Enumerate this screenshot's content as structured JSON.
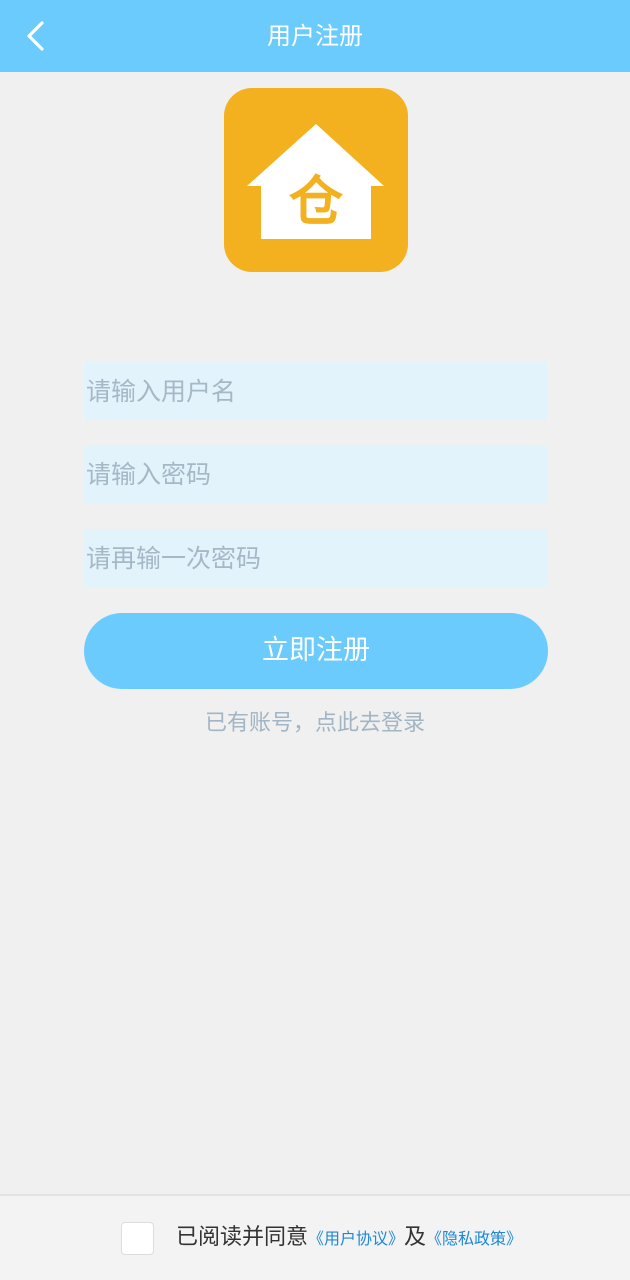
{
  "header": {
    "title": "用户注册",
    "back_icon": "chevron-left-icon"
  },
  "logo": {
    "glyph": "仓",
    "icon": "house-logo-icon",
    "tile_color": "#f3b11f",
    "glyph_color": "#f3b11f"
  },
  "form": {
    "username_placeholder": "请输入用户名",
    "password_placeholder": "请输入密码",
    "confirm_password_placeholder": "请再输一次密码",
    "username_value": "",
    "password_value": "",
    "confirm_password_value": "",
    "register_label": "立即注册",
    "login_link": "已有账号，点此去登录"
  },
  "footer": {
    "agree_text": "已阅读并同意",
    "user_agreement_link": "《用户协议》",
    "and_text": "及",
    "privacy_policy_link": "《隐私政策》",
    "checked": false
  },
  "colors": {
    "header_bg": "#6ccbfd",
    "field_bg": "#e2f3fc",
    "button_bg": "#6ccbfd",
    "link": "#1e88d6",
    "page_bg": "#f0f0f0"
  }
}
